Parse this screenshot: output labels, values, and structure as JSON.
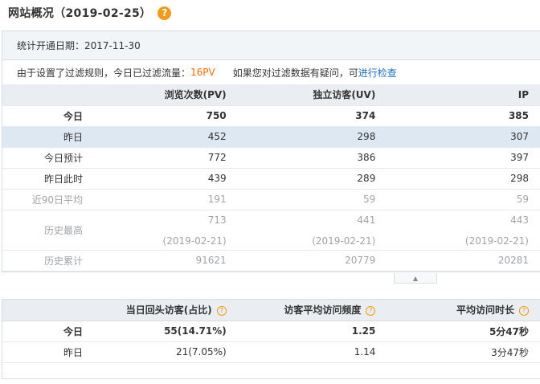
{
  "header": {
    "title": "网站概况（2019-02-25）",
    "help_icon": "?"
  },
  "panel": {
    "open_date": "统计开通日期：2017-11-30",
    "filter_text_1": "由于设置了过滤规则，今日已过滤流量：",
    "filter_value": "16PV",
    "filter_text_2": "如果您对过滤数据有疑问，可",
    "filter_link": "进行检查"
  },
  "overview": {
    "columns": [
      "",
      "浏览次数(PV)",
      "独立访客(UV)",
      "IP"
    ],
    "rows": [
      {
        "label": "今日",
        "pv": "750",
        "uv": "374",
        "ip": "385"
      },
      {
        "label": "昨日",
        "pv": "452",
        "uv": "298",
        "ip": "307"
      },
      {
        "label": "今日预计",
        "pv": "772",
        "uv": "386",
        "ip": "397"
      },
      {
        "label": "昨日此时",
        "pv": "439",
        "uv": "289",
        "ip": "298"
      },
      {
        "label": "近90日平均",
        "pv": "191",
        "uv": "59",
        "ip": "59"
      },
      {
        "label": "历史最高",
        "pv": "713",
        "uv": "441",
        "ip": "443",
        "pv_date": "(2019-02-21)",
        "uv_date": "(2019-02-21)",
        "ip_date": "(2019-02-21)"
      },
      {
        "label": "历史累计",
        "pv": "91621",
        "uv": "20779",
        "ip": "20281"
      }
    ]
  },
  "collapse_icon": "▲",
  "visitors": {
    "columns": [
      "",
      "当日回头访客(占比)",
      "访客平均访问频度",
      "平均访问时长"
    ],
    "rows": [
      {
        "label": "今日",
        "return": "55(14.71%)",
        "freq": "1.25",
        "duration": "5分47秒"
      },
      {
        "label": "昨日",
        "return": "21(7.05%)",
        "freq": "1.14",
        "duration": "3分47秒"
      }
    ]
  }
}
